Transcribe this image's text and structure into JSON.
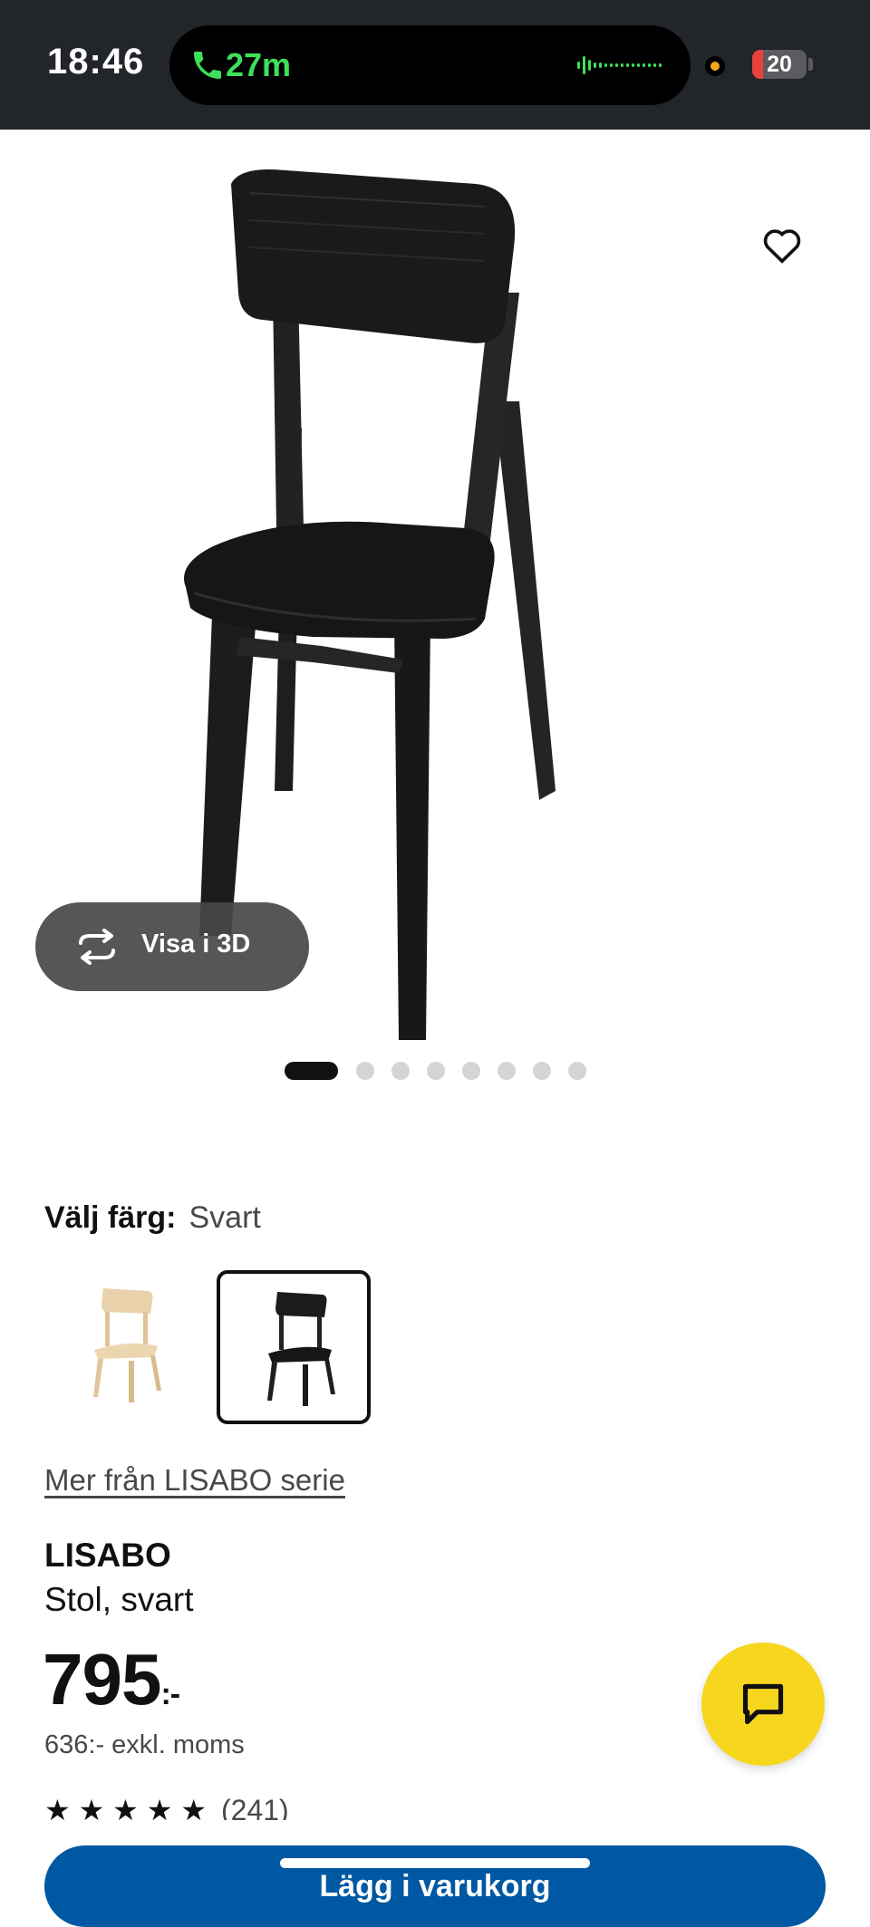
{
  "status_bar": {
    "time": "18:46",
    "call_duration": "27m",
    "battery_level": "20",
    "battery_fraction": 0.2,
    "battery_color": "#e8433b",
    "call_color": "#3ee05a",
    "mic_indicator_color": "#f5a623"
  },
  "hero": {
    "wishlist_icon": "heart-outline-icon",
    "view_3d_label": "Visa i 3D",
    "view_3d_icon": "rotate-3d-icon",
    "carousel_total": 8,
    "carousel_active_index": 0
  },
  "color_picker": {
    "label": "Välj färg:",
    "selected_value": "Svart",
    "options": [
      {
        "name": "birch",
        "color": "#e7cfa6",
        "selected": false
      },
      {
        "name": "black",
        "color": "#2b2b2b",
        "selected": true
      }
    ]
  },
  "series_link": "Mer från LISABO serie",
  "product": {
    "name": "LISABO",
    "description": "Stol, svart",
    "price": "795",
    "price_suffix": ":-",
    "price_excl_vat": "636:- exkl. moms",
    "rating_stars": "★ ★ ★ ★ ★",
    "rating_count": "(241)"
  },
  "chat": {
    "icon": "chat-bubble-icon",
    "color": "#f7d61e"
  },
  "buy_button": {
    "label": "Lägg i varukorg",
    "color": "#0058a3"
  }
}
